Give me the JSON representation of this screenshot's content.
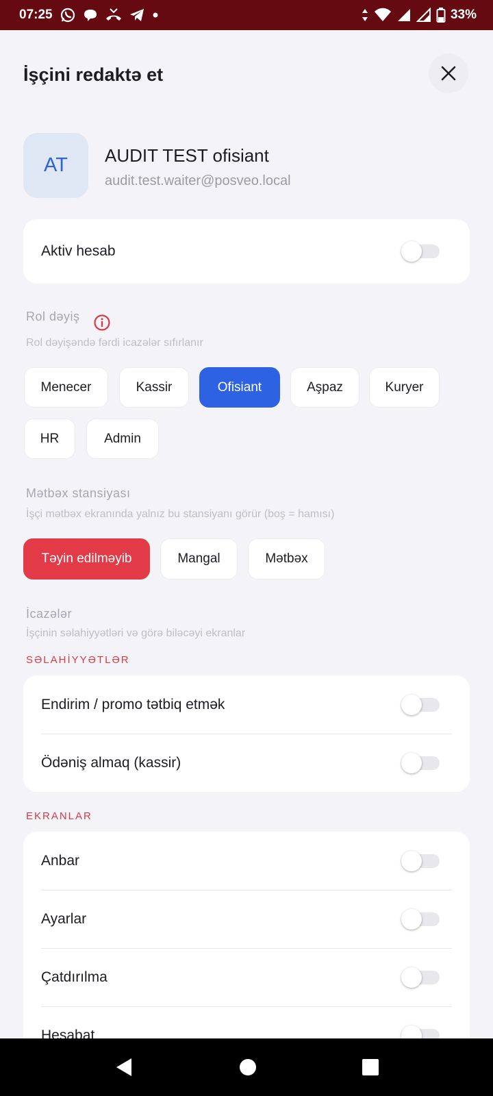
{
  "status_bar": {
    "time": "07:25",
    "battery": "33%",
    "notification_icons": [
      "whatsapp-icon",
      "chat-icon",
      "missed-call-icon",
      "telegram-icon",
      "dot-icon"
    ]
  },
  "header": {
    "title": "İşçini redaktə et",
    "close_icon": "close-icon"
  },
  "user": {
    "initials": "AT",
    "name": "AUDIT TEST ofisiant",
    "email": "audit.test.waiter@posveo.local"
  },
  "active_account": {
    "label": "Aktiv hesab",
    "enabled": false
  },
  "role_section": {
    "title": "Rol dəyiş",
    "subtitle": "Rol dəyişəndə fərdi icazələr sıfırlanır",
    "options": [
      "Menecer",
      "Kassir",
      "Ofisiant",
      "Aşpaz",
      "Kuryer",
      "HR",
      "Admin"
    ],
    "selected": "Ofisiant"
  },
  "station_section": {
    "title": "Mətbəx stansiyası",
    "subtitle": "İşçi mətbəx ekranında yalnız bu stansiyanı görür (boş = hamısı)",
    "options": [
      "Təyin edilməyib",
      "Mangal",
      "Mətbəx"
    ],
    "selected": "Təyin edilməyib"
  },
  "permissions_section": {
    "title": "İcazələr",
    "subtitle": "İşçinin səlahiyyətləri və görə biləcəyi ekranlar",
    "groups": [
      {
        "label": "SƏLAHİYYƏTLƏR",
        "items": [
          {
            "label": "Endirim / promo tətbiq etmək",
            "enabled": false
          },
          {
            "label": "Ödəniş almaq (kassir)",
            "enabled": false
          }
        ]
      },
      {
        "label": "EKRANLAR",
        "items": [
          {
            "label": "Anbar",
            "enabled": false
          },
          {
            "label": "Ayarlar",
            "enabled": false
          },
          {
            "label": "Çatdırılma",
            "enabled": false
          },
          {
            "label": "Hesabat",
            "enabled": false
          }
        ]
      }
    ]
  },
  "colors": {
    "status_bar": "#650a10",
    "primary_blue": "#2d62e3",
    "accent_red": "#e23a46"
  }
}
